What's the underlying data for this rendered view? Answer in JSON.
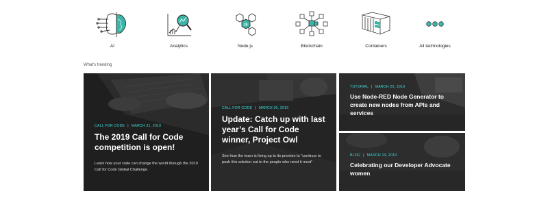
{
  "technologies": [
    {
      "label": "AI",
      "icon": "ai-brain-icon"
    },
    {
      "label": "Analytics",
      "icon": "analytics-magnifier-icon"
    },
    {
      "label": "Node.js",
      "icon": "nodejs-hexagon-icon"
    },
    {
      "label": "Blockchain",
      "icon": "blockchain-cubes-icon"
    },
    {
      "label": "Containers",
      "icon": "containers-icon"
    },
    {
      "label": "All technologies",
      "icon": "dots-icon"
    }
  ],
  "trending": {
    "label": "What's trending",
    "cards": [
      {
        "category": "CALL FOR CODE",
        "date": "MARCH 21, 2019",
        "title": "The 2019 Call for Code competition is open!",
        "description": "Learn how your code can change the world through the 2019 Call for Code Global Challenge."
      },
      {
        "category": "CALL FOR CODE",
        "date": "MARCH 26, 2019",
        "title": "Update: Catch up with last year’s Call for Code winner, Project Owl",
        "description": "See how the team is living up to its promise to “continue to push this solution out to the people who need it most”"
      },
      {
        "category": "TUTORIAL",
        "date": "MARCH 25, 2019",
        "title": "Use Node-RED Node Generator to create new nodes from APIs and services"
      },
      {
        "category": "BLOG",
        "date": "MARCH 14, 2019",
        "title": "Celebrating our Developer Advocate women"
      }
    ]
  },
  "colors": {
    "accent": "#3ddbd9",
    "icon_teal": "#3ab5a8",
    "card_bg": "#2b2b2b"
  }
}
